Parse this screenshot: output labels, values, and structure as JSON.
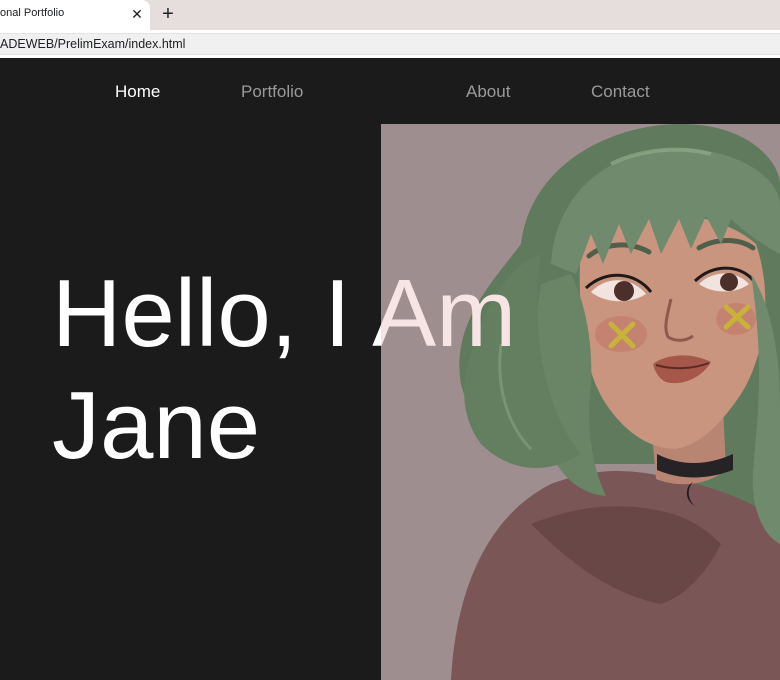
{
  "browser": {
    "tab_title": "onal Portfolio",
    "close_glyph": "✕",
    "new_tab_glyph": "+",
    "url": "ADEWEB/PrelimExam/index.html"
  },
  "nav": {
    "items": [
      {
        "label": "Home",
        "active": true
      },
      {
        "label": "Portfolio",
        "active": false
      },
      {
        "label": "About",
        "active": false
      },
      {
        "label": "Contact",
        "active": false
      }
    ]
  },
  "hero": {
    "heading_line1": "Hello, I Am",
    "heading_line2": "Jane",
    "image_description_icon": "portrait-illustration"
  },
  "colors": {
    "page_background": "#1b1b1b",
    "image_background": "#9e8e90",
    "nav_active": "#ffffff",
    "nav_inactive": "#9a9a9a",
    "hair": "#6f8a6c",
    "hoodie": "#7a5656"
  }
}
